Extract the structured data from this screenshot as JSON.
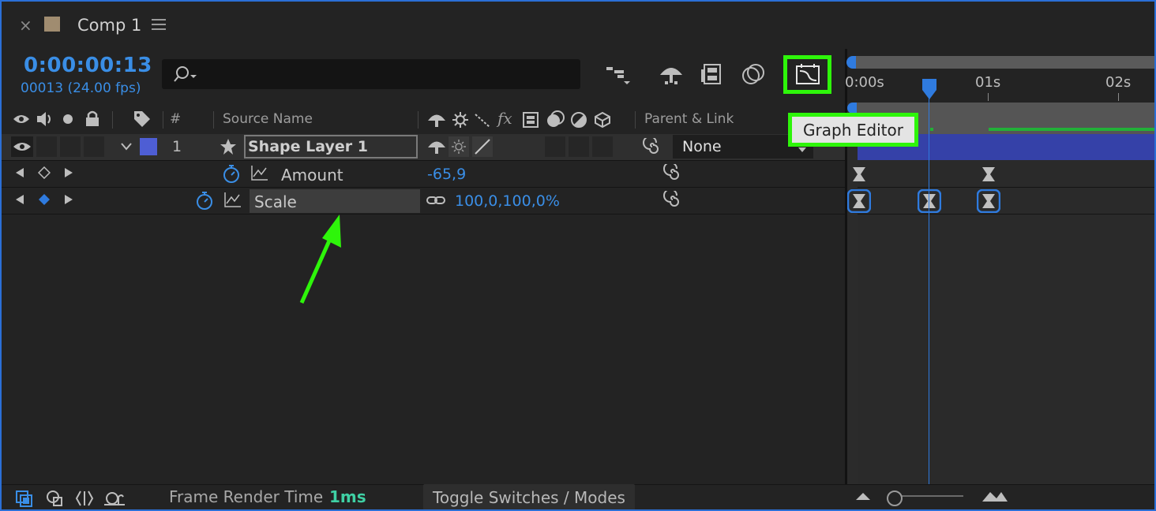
{
  "tab": {
    "close": "×",
    "title": "Comp 1"
  },
  "time": {
    "timecode": "0:00:00:13",
    "frames": "00013 (24.00 fps)"
  },
  "search": {
    "placeholder": ""
  },
  "headers": {
    "num": "#",
    "source_name": "Source Name",
    "fx": "fx",
    "parent": "Parent & Link"
  },
  "layer": {
    "number": "1",
    "name": "Shape Layer 1",
    "parent": "None",
    "color": "#4e5ed4"
  },
  "properties": [
    {
      "name": "Amount",
      "value": "-65,9"
    },
    {
      "name": "Scale",
      "value": "100,0,100,0%"
    }
  ],
  "timeline": {
    "ruler": [
      "0:00s",
      "01s",
      "02s"
    ]
  },
  "tooltip": {
    "text": "Graph Editor"
  },
  "bottom": {
    "render_label": "Frame Render Time",
    "render_value": "1ms",
    "toggle": "Toggle Switches / Modes"
  },
  "colors": {
    "accent": "#3a8ee6",
    "highlight": "#2ef50a",
    "layer_bar": "#3541a8"
  }
}
